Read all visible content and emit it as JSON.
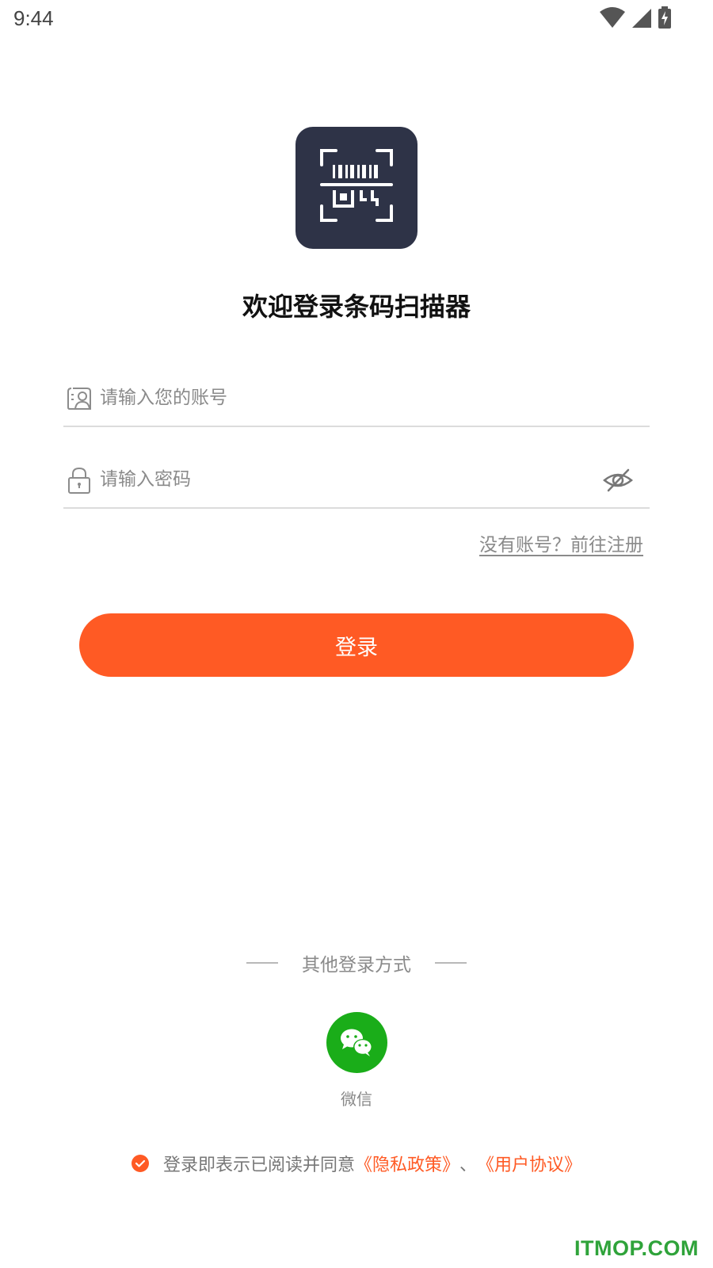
{
  "status_bar": {
    "time": "9:44",
    "icons": [
      "wifi-icon",
      "signal-icon",
      "battery-charging-icon"
    ]
  },
  "app": {
    "logo_icon": "barcode-scanner-icon",
    "welcome_title": "欢迎登录条码扫描器"
  },
  "form": {
    "account_placeholder": "请输入您的账号",
    "password_placeholder": "请输入密码",
    "account_value": "",
    "password_value": "",
    "register_link": "没有账号？前往注册",
    "login_button": "登录"
  },
  "other_login": {
    "label": "其他登录方式",
    "wechat_label": "微信"
  },
  "agreement": {
    "prefix": "登录即表示已阅读并同意",
    "privacy_link": "《隐私政策》",
    "separator": "、",
    "terms_link": "《用户协议》",
    "checked": true
  },
  "watermark": "ITMOP.COM",
  "colors": {
    "accent": "#ff5a24",
    "logo_bg": "#2e3347",
    "wechat": "#1aad19",
    "watermark": "#2fa33a"
  }
}
